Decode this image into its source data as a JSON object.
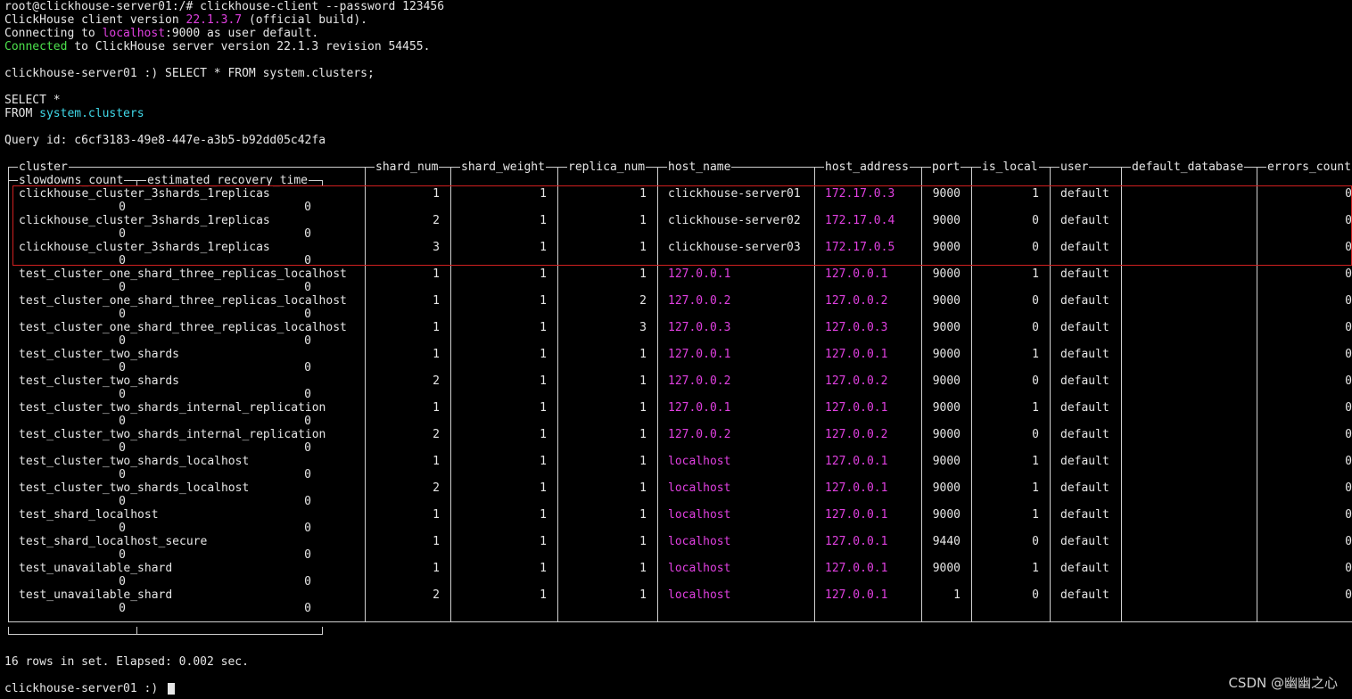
{
  "session": {
    "line1": "root@clickhouse-server01:/# clickhouse-client --password 123456",
    "line2_a": "ClickHouse client version ",
    "line2_ver": "22.1.3.7",
    "line2_b": " (official build).",
    "line3_a": "Connecting to ",
    "line3_host": "localhost",
    "line3_b": ":9000 as user default.",
    "line4_a": "Connected",
    "line4_b": " to ClickHouse server version 22.1.3 revision 54455.",
    "prompt_query": "clickhouse-server01 :) SELECT * FROM system.clusters;",
    "fmt_select": "SELECT *",
    "fmt_from": "FROM ",
    "fmt_table": "system.clusters",
    "query_id": "Query id: c6cf3183-49e8-447e-a3b5-b92dd05c42fa",
    "rows_info": "16 rows in set. Elapsed: 0.002 sec.",
    "final_prompt": "clickhouse-server01 :) "
  },
  "columns": {
    "cluster": "cluster",
    "shard_num": "shard_num",
    "shard_weight": "shard_weight",
    "replica_num": "replica_num",
    "host_name": "host_name",
    "host_address": "host_address",
    "port": "port",
    "is_local": "is_local",
    "user": "user",
    "default_database": "default_database",
    "errors_count": "errors_count",
    "slowdowns_count": "slowdowns_count",
    "estimated_recovery_time": "estimated_recovery_time"
  },
  "rows": [
    {
      "cluster": "clickhouse_cluster_3shards_1replicas",
      "shard_num": "1",
      "shard_weight": "1",
      "replica_num": "1",
      "host_name": "clickhouse-server01",
      "host_address": "172.17.0.3",
      "port": "9000",
      "is_local": "1",
      "user": "default",
      "errors_count": "0",
      "slowdowns_count": "0",
      "estimated_recovery_time": "0"
    },
    {
      "cluster": "clickhouse_cluster_3shards_1replicas",
      "shard_num": "2",
      "shard_weight": "1",
      "replica_num": "1",
      "host_name": "clickhouse-server02",
      "host_address": "172.17.0.4",
      "port": "9000",
      "is_local": "0",
      "user": "default",
      "errors_count": "0",
      "slowdowns_count": "0",
      "estimated_recovery_time": "0"
    },
    {
      "cluster": "clickhouse_cluster_3shards_1replicas",
      "shard_num": "3",
      "shard_weight": "1",
      "replica_num": "1",
      "host_name": "clickhouse-server03",
      "host_address": "172.17.0.5",
      "port": "9000",
      "is_local": "0",
      "user": "default",
      "errors_count": "0",
      "slowdowns_count": "0",
      "estimated_recovery_time": "0"
    },
    {
      "cluster": "test_cluster_one_shard_three_replicas_localhost",
      "shard_num": "1",
      "shard_weight": "1",
      "replica_num": "1",
      "host_name": "127.0.0.1",
      "host_address": "127.0.0.1",
      "port": "9000",
      "is_local": "1",
      "user": "default",
      "errors_count": "0",
      "slowdowns_count": "0",
      "estimated_recovery_time": "0"
    },
    {
      "cluster": "test_cluster_one_shard_three_replicas_localhost",
      "shard_num": "1",
      "shard_weight": "1",
      "replica_num": "2",
      "host_name": "127.0.0.2",
      "host_address": "127.0.0.2",
      "port": "9000",
      "is_local": "0",
      "user": "default",
      "errors_count": "0",
      "slowdowns_count": "0",
      "estimated_recovery_time": "0"
    },
    {
      "cluster": "test_cluster_one_shard_three_replicas_localhost",
      "shard_num": "1",
      "shard_weight": "1",
      "replica_num": "3",
      "host_name": "127.0.0.3",
      "host_address": "127.0.0.3",
      "port": "9000",
      "is_local": "0",
      "user": "default",
      "errors_count": "0",
      "slowdowns_count": "0",
      "estimated_recovery_time": "0"
    },
    {
      "cluster": "test_cluster_two_shards",
      "shard_num": "1",
      "shard_weight": "1",
      "replica_num": "1",
      "host_name": "127.0.0.1",
      "host_address": "127.0.0.1",
      "port": "9000",
      "is_local": "1",
      "user": "default",
      "errors_count": "0",
      "slowdowns_count": "0",
      "estimated_recovery_time": "0"
    },
    {
      "cluster": "test_cluster_two_shards",
      "shard_num": "2",
      "shard_weight": "1",
      "replica_num": "1",
      "host_name": "127.0.0.2",
      "host_address": "127.0.0.2",
      "port": "9000",
      "is_local": "0",
      "user": "default",
      "errors_count": "0",
      "slowdowns_count": "0",
      "estimated_recovery_time": "0"
    },
    {
      "cluster": "test_cluster_two_shards_internal_replication",
      "shard_num": "1",
      "shard_weight": "1",
      "replica_num": "1",
      "host_name": "127.0.0.1",
      "host_address": "127.0.0.1",
      "port": "9000",
      "is_local": "1",
      "user": "default",
      "errors_count": "0",
      "slowdowns_count": "0",
      "estimated_recovery_time": "0"
    },
    {
      "cluster": "test_cluster_two_shards_internal_replication",
      "shard_num": "2",
      "shard_weight": "1",
      "replica_num": "1",
      "host_name": "127.0.0.2",
      "host_address": "127.0.0.2",
      "port": "9000",
      "is_local": "0",
      "user": "default",
      "errors_count": "0",
      "slowdowns_count": "0",
      "estimated_recovery_time": "0"
    },
    {
      "cluster": "test_cluster_two_shards_localhost",
      "shard_num": "1",
      "shard_weight": "1",
      "replica_num": "1",
      "host_name": "localhost",
      "host_address": "127.0.0.1",
      "port": "9000",
      "is_local": "1",
      "user": "default",
      "errors_count": "0",
      "slowdowns_count": "0",
      "estimated_recovery_time": "0"
    },
    {
      "cluster": "test_cluster_two_shards_localhost",
      "shard_num": "2",
      "shard_weight": "1",
      "replica_num": "1",
      "host_name": "localhost",
      "host_address": "127.0.0.1",
      "port": "9000",
      "is_local": "1",
      "user": "default",
      "errors_count": "0",
      "slowdowns_count": "0",
      "estimated_recovery_time": "0"
    },
    {
      "cluster": "test_shard_localhost",
      "shard_num": "1",
      "shard_weight": "1",
      "replica_num": "1",
      "host_name": "localhost",
      "host_address": "127.0.0.1",
      "port": "9000",
      "is_local": "1",
      "user": "default",
      "errors_count": "0",
      "slowdowns_count": "0",
      "estimated_recovery_time": "0"
    },
    {
      "cluster": "test_shard_localhost_secure",
      "shard_num": "1",
      "shard_weight": "1",
      "replica_num": "1",
      "host_name": "localhost",
      "host_address": "127.0.0.1",
      "port": "9440",
      "is_local": "0",
      "user": "default",
      "errors_count": "0",
      "slowdowns_count": "0",
      "estimated_recovery_time": "0"
    },
    {
      "cluster": "test_unavailable_shard",
      "shard_num": "1",
      "shard_weight": "1",
      "replica_num": "1",
      "host_name": "localhost",
      "host_address": "127.0.0.1",
      "port": "9000",
      "is_local": "1",
      "user": "default",
      "errors_count": "0",
      "slowdowns_count": "0",
      "estimated_recovery_time": "0"
    },
    {
      "cluster": "test_unavailable_shard",
      "shard_num": "2",
      "shard_weight": "1",
      "replica_num": "1",
      "host_name": "localhost",
      "host_address": "127.0.0.1",
      "port": "1",
      "is_local": "0",
      "user": "default",
      "errors_count": "0",
      "slowdowns_count": "0",
      "estimated_recovery_time": "0"
    }
  ],
  "colors": {
    "green": "#4ce04c",
    "magenta": "#e040e0",
    "cyan": "#40d8e8",
    "highlight_box": "#d02020"
  },
  "watermark": "CSDN @幽幽之心"
}
